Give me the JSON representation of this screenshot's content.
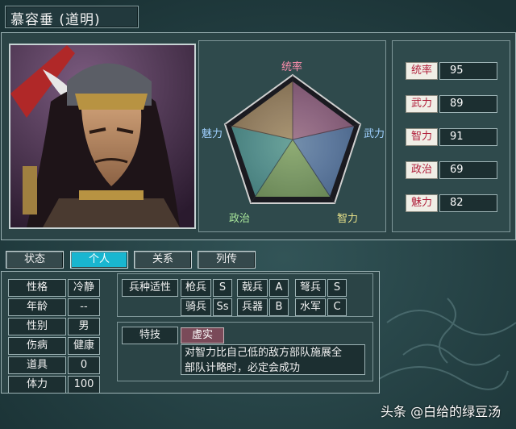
{
  "character": {
    "name": "慕容垂 (道明)"
  },
  "radar": {
    "labels": {
      "top": "统率",
      "right": "武力",
      "bottom_right": "智力",
      "bottom_left": "政治",
      "left": "魅力"
    }
  },
  "stats": [
    {
      "label": "统率",
      "value": "95"
    },
    {
      "label": "武力",
      "value": "89"
    },
    {
      "label": "智力",
      "value": "91"
    },
    {
      "label": "政治",
      "value": "69"
    },
    {
      "label": "魅力",
      "value": "82"
    }
  ],
  "tabs": [
    {
      "label": "状态",
      "active": false
    },
    {
      "label": "个人",
      "active": true
    },
    {
      "label": "关系",
      "active": false
    },
    {
      "label": "列传",
      "active": false
    }
  ],
  "personal": [
    {
      "label": "性格",
      "value": "冷静"
    },
    {
      "label": "年龄",
      "value": "--"
    },
    {
      "label": "性别",
      "value": "男"
    },
    {
      "label": "伤病",
      "value": "健康"
    },
    {
      "label": "道具",
      "value": "0"
    },
    {
      "label": "体力",
      "value": "100"
    }
  ],
  "troop_fitness": {
    "header": "兵种适性",
    "row1": [
      {
        "label": "枪兵",
        "grade": "S"
      },
      {
        "label": "戟兵",
        "grade": "A"
      },
      {
        "label": "弩兵",
        "grade": "S"
      }
    ],
    "row2": [
      {
        "label": "骑兵",
        "grade": "Ss"
      },
      {
        "label": "兵器",
        "grade": "B"
      },
      {
        "label": "水军",
        "grade": "C"
      }
    ]
  },
  "skill": {
    "header": "特技",
    "name": "虚实",
    "description": "对智力比自己低的敌方部队施展全\n部队计略时，必定会成功"
  },
  "watermark": "头条 @白给的绿豆汤",
  "colors": {
    "accent_tab": "#19b6d0",
    "stat_label_text": "#b01e3a",
    "skill_badge": "#7a4a59"
  }
}
